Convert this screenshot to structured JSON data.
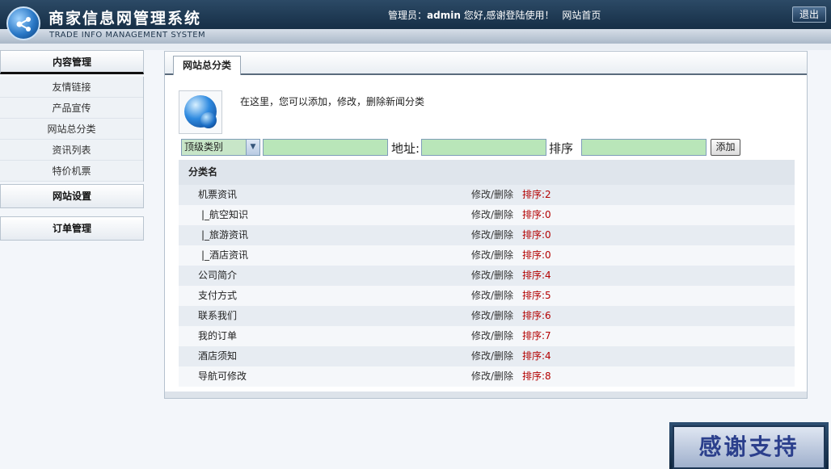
{
  "header": {
    "title": "商家信息网管理系统",
    "subtitle": "TRADE INFO MANAGEMENT SYSTEM",
    "welcome_prefix": "管理员：",
    "admin_name": "admin",
    "welcome_suffix": " 您好,感谢登陆使用！",
    "home_link": "网站首页",
    "logout_label": "退出"
  },
  "sidebar": {
    "content_mgmt": "内容管理",
    "items": [
      "友情链接",
      "产品宣传",
      "网站总分类",
      "资讯列表",
      "特价机票"
    ],
    "site_settings": "网站设置",
    "order_mgmt": "订单管理"
  },
  "main": {
    "tab_label": "网站总分类",
    "intro": "在这里，您可以添加，修改，删除新闻分类",
    "select_value": "顶级类别",
    "address_label": "地址:",
    "sort_label": "排序",
    "add_button": "添加",
    "table_header": "分类名",
    "rows": [
      {
        "name": "机票资讯",
        "ops": "修改/删除",
        "sort": "排序:2"
      },
      {
        "name": "|_航空知识",
        "ops": "修改/删除",
        "sort": "排序:0"
      },
      {
        "name": "|_旅游资讯",
        "ops": "修改/删除",
        "sort": "排序:0"
      },
      {
        "name": "|_酒店资讯",
        "ops": "修改/删除",
        "sort": "排序:0"
      },
      {
        "name": "公司简介",
        "ops": "修改/删除",
        "sort": "排序:4"
      },
      {
        "name": "支付方式",
        "ops": "修改/删除",
        "sort": "排序:5"
      },
      {
        "name": "联系我们",
        "ops": "修改/删除",
        "sort": "排序:6"
      },
      {
        "name": "我的订单",
        "ops": "修改/删除",
        "sort": "排序:7"
      },
      {
        "name": "酒店须知",
        "ops": "修改/删除",
        "sort": "排序:4"
      },
      {
        "name": "导航可修改",
        "ops": "修改/删除",
        "sort": "排序:8"
      }
    ]
  },
  "banner": {
    "text": "感谢支持"
  }
}
